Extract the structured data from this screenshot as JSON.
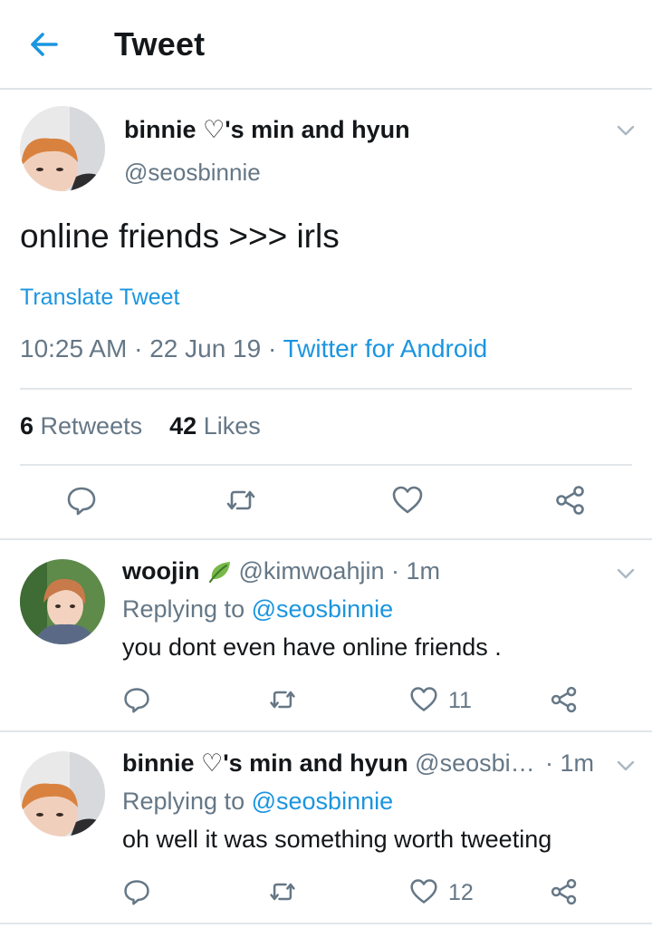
{
  "header": {
    "title": "Tweet"
  },
  "main_tweet": {
    "display_name": "binnie ♡'s min and hyun",
    "handle": "@seosbinnie",
    "text": "online friends >>> irls",
    "translate_label": "Translate Tweet",
    "time": "10:25 AM",
    "separator": "·",
    "date": "22 Jun 19",
    "source": "Twitter for Android",
    "retweets_count": "6",
    "retweets_label": "Retweets",
    "likes_count": "42",
    "likes_label": "Likes"
  },
  "replies": [
    {
      "display_name": "woojin",
      "emoji": "leaf",
      "handle": "@kimwoahjin",
      "time": "· 1m",
      "replying_prefix": "Replying to",
      "replying_to": "@seosbinnie",
      "text": "you dont even have online friends .",
      "like_count": "11"
    },
    {
      "display_name": "binnie ♡'s min and hyun",
      "handle": "@seosbi…",
      "time": "· 1m",
      "replying_prefix": "Replying to",
      "replying_to": "@seosbinnie",
      "text": "oh well it was something worth tweeting",
      "like_count": "12"
    }
  ],
  "icons": [
    "back-arrow-icon",
    "chevron-down-icon",
    "reply-icon",
    "retweet-icon",
    "like-icon",
    "share-icon"
  ],
  "colors": {
    "accent": "#1b95e0",
    "text": "#14171a",
    "secondary": "#657786",
    "divider": "#e1e6ea"
  }
}
